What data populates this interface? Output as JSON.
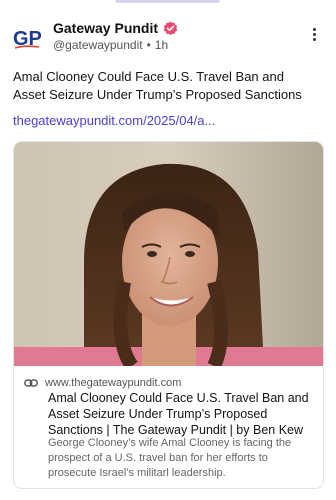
{
  "post": {
    "author_name": "Gateway Pundit",
    "handle": "@gatewaypundit",
    "separator": "•",
    "time": "1h",
    "avatar_text": "GP",
    "verified_color": "#e94c6f",
    "text": "Amal Clooney Could Face U.S. Travel Ban and Asset Seizure Under Trump’s Proposed Sanctions",
    "link": "thegatewaypundit.com/2025/04/a...",
    "link_color": "#4a3fd1"
  },
  "card": {
    "domain": "www.thegatewaypundit.com",
    "title": "Amal Clooney Could Face U.S. Travel Ban and Asset Seizure Under Trump’s Proposed Sanctions | The Gateway Pundit | by Ben Kew",
    "description": "George Clooney’s wife Amal Clooney is facing the prospect of a U.S. travel ban for her efforts to prosecute Israel’s militarl leadership."
  },
  "icons": {
    "verified": "verified-badge-icon",
    "more": "more-options-icon",
    "link": "link-icon"
  }
}
